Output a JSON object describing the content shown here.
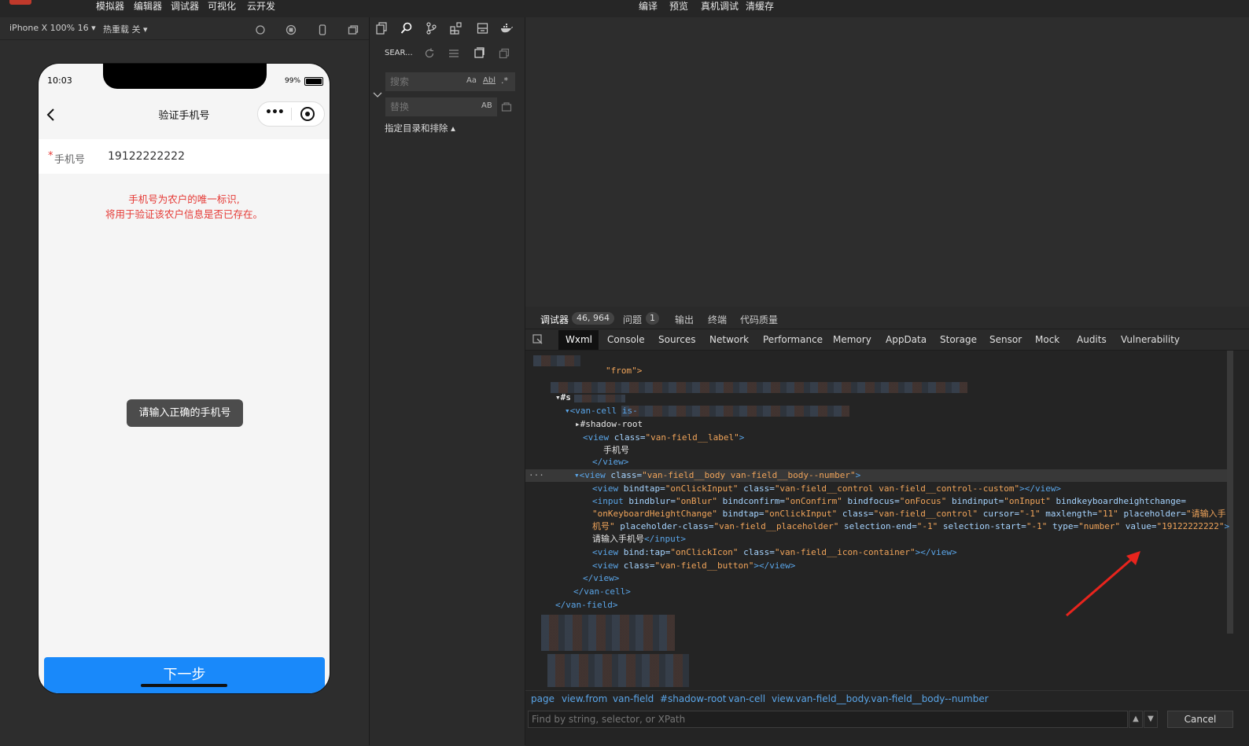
{
  "menu": {
    "left": [
      "模拟器",
      "编辑器",
      "调试器",
      "可视化",
      "云开发"
    ],
    "center": [
      "编译",
      "预览",
      "真机调试",
      "清缓存"
    ]
  },
  "simulator": {
    "device": "iPhone X 100% 16",
    "hot_reload": "热重载 关",
    "phone": {
      "time": "10:03",
      "battery": "99%",
      "title": "验证手机号",
      "field_star": "*",
      "field_label": "手机号",
      "field_value": "19122222222",
      "hint_line1": "手机号为农户的唯一标识,",
      "hint_line2": "将用于验证该农户信息是否已存在。",
      "toast": "请输入正确的手机号",
      "next_button": "下一步"
    }
  },
  "search": {
    "header": "SEAR...",
    "search_placeholder": "搜索",
    "replace_placeholder": "替换",
    "opt_case": "Aa",
    "opt_word": "Abl",
    "opt_preserve": "AB",
    "include_exclude": "指定目录和排除 ▴"
  },
  "devtools": {
    "top_tabs": [
      {
        "label": "调试器",
        "badge": "46, 964"
      },
      {
        "label": "问题",
        "badge": "1"
      },
      {
        "label": "输出"
      },
      {
        "label": "终端"
      },
      {
        "label": "代码质量"
      }
    ],
    "panel_tabs": [
      "Wxml",
      "Console",
      "Sources",
      "Network",
      "Performance",
      "Memory",
      "AppData",
      "Storage",
      "Sensor",
      "Mock",
      "Audits",
      "Vulnerability"
    ],
    "code": {
      "l1": "\"from\">",
      "l3": "▾#s",
      "l4": "▾<van-cell is-",
      "l5": "▸#shadow-root",
      "l6_tag": "<view ",
      "l6_attr": "class=",
      "l6_val": "\"van-field__label\"",
      "l6_end": ">",
      "l7": "手机号",
      "l8": "</view>",
      "l9_tag": "▾<view ",
      "l9_attr": "class=",
      "l9_val": "\"van-field__body van-field__body--number\"",
      "l9_end": ">",
      "l10_tag": "<view ",
      "l10_a1": "bindtap=",
      "l10_v1": "\"onClickInput\"",
      "l10_a2": " class=",
      "l10_v2": "\"van-field__control van-field__control--custom\"",
      "l10_end": "></view>",
      "l11_tag": "<input ",
      "l11_a1": "bindblur=",
      "l11_v1": "\"onBlur\"",
      "l11_a2": " bindconfirm=",
      "l11_v2": "\"onConfirm\"",
      "l11_a3": " bindfocus=",
      "l11_v3": "\"onFocus\"",
      "l11_a4": " bindinput=",
      "l11_v4": "\"onInput\"",
      "l11_a5": " bindkeyboardheightchange=",
      "l12_v1": "\"onKeyboardHeightChange\"",
      "l12_a2": " bindtap=",
      "l12_v2": "\"onClickInput\"",
      "l12_a3": " class=",
      "l12_v3": "\"van-field__control\"",
      "l12_a4": " cursor=",
      "l12_v4": "\"-1\"",
      "l12_a5": " maxlength=",
      "l12_v5": "\"11\"",
      "l12_a6": " placeholder=",
      "l12_v6": "\"请输入手",
      "l13_v0": "机号\"",
      "l13_a1": " placeholder-class=",
      "l13_v1": "\"van-field__placeholder\"",
      "l13_a2": " selection-end=",
      "l13_v2": "\"-1\"",
      "l13_a3": " selection-start=",
      "l13_v3": "\"-1\"",
      "l13_a4": " type=",
      "l13_v4": "\"number\"",
      "l13_a5": " value=",
      "l13_v5": "\"19122222222\"",
      "l13_end": ">",
      "l14_txt": "请输入手机号",
      "l14_end": "</input>",
      "l15_tag": "<view ",
      "l15_a1": "bind:tap=",
      "l15_v1": "\"onClickIcon\"",
      "l15_a2": " class=",
      "l15_v2": "\"van-field__icon-container\"",
      "l15_end": "></view>",
      "l16_tag": "<view ",
      "l16_a1": "class=",
      "l16_v1": "\"van-field__button\"",
      "l16_end": "></view>",
      "l17": "</view>",
      "l18": "</van-cell>",
      "l19": "</van-field>"
    },
    "breadcrumbs": [
      "page",
      "view.from",
      "van-field",
      "#shadow-root",
      "van-cell",
      "view.van-field__body.van-field__body--number"
    ],
    "find_placeholder": "Find by string, selector, or XPath",
    "cancel": "Cancel"
  },
  "colors": {
    "primary_button": "#1989fa",
    "error_text": "#e53935",
    "code_tag": "#5aa5e8",
    "code_value": "#f0a45a",
    "annotation_arrow": "#e8241d"
  }
}
